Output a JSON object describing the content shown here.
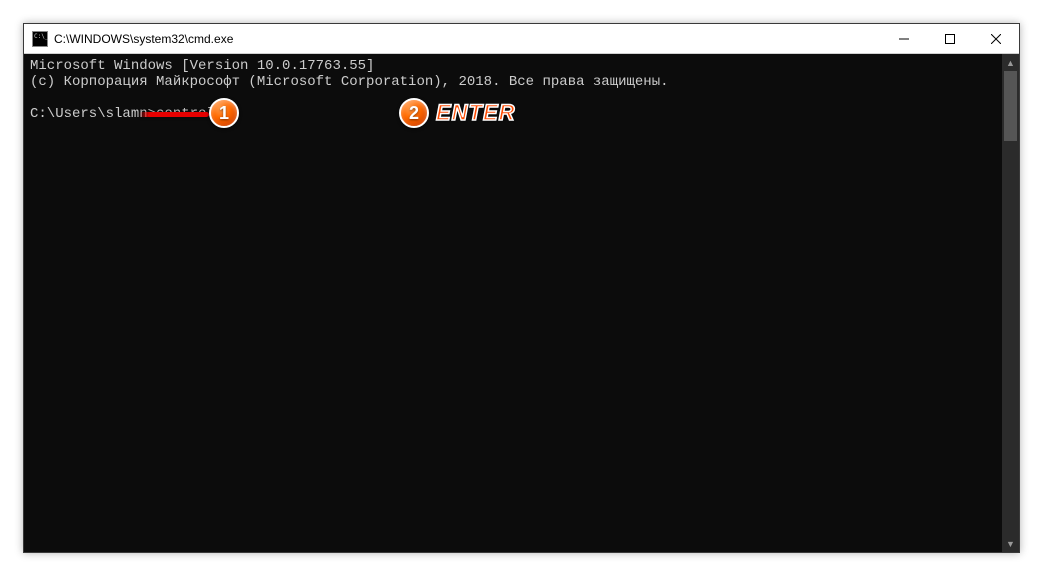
{
  "window": {
    "title": "C:\\WINDOWS\\system32\\cmd.exe"
  },
  "console": {
    "line1": "Microsoft Windows [Version 10.0.17763.55]",
    "line2": "(c) Корпорация Майкрософт (Microsoft Corporation), 2018. Все права защищены.",
    "blank": "",
    "prompt": "C:\\Users\\slamn>",
    "command": "control"
  },
  "annotations": {
    "badge1": "1",
    "badge2": "2",
    "enter": "ENTER"
  },
  "controls": {
    "minimize": "Minimize",
    "maximize": "Maximize",
    "close": "Close"
  }
}
